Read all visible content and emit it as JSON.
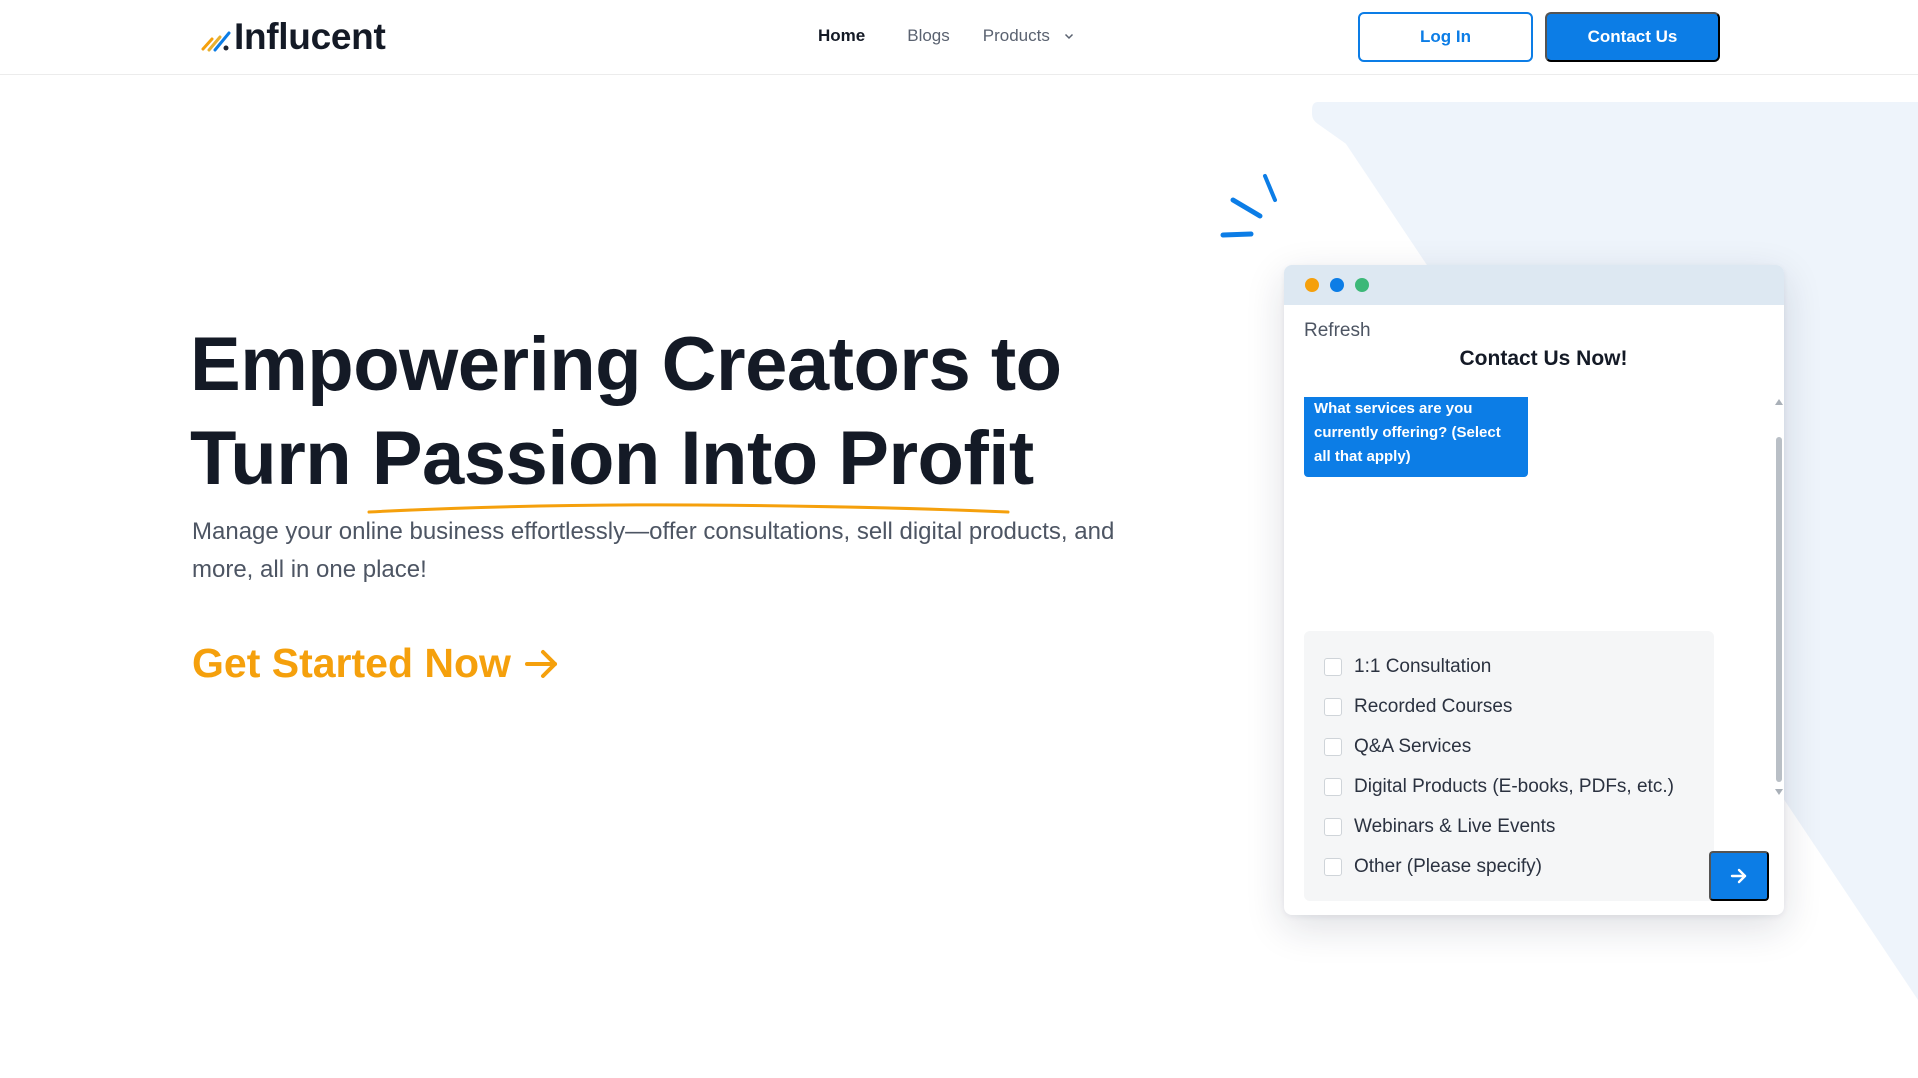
{
  "brand": {
    "name": "Influcent"
  },
  "nav": {
    "home": "Home",
    "blogs": "Blogs",
    "products": "Products"
  },
  "header_buttons": {
    "login": "Log In",
    "contact": "Contact Us"
  },
  "hero": {
    "title_line1": "Empowering Creators to",
    "title_line2_prefix": "Turn ",
    "title_line2_highlight": "Passion Into Profit",
    "subtitle": "Manage your online business effortlessly—offer consultations, sell digital products, and more, all in one place!",
    "cta": "Get Started Now"
  },
  "contact_card": {
    "refresh": "Refresh",
    "title": "Contact Us Now!",
    "question": "What services are you currently offering? (Select all that apply)",
    "options": [
      "1:1 Consultation",
      "Recorded Courses",
      "Q&A Services",
      "Digital Products (E-books, PDFs, etc.)",
      "Webinars & Live Events",
      "Other (Please specify)"
    ],
    "window_dots": [
      "#f5a00c",
      "#0c7de6",
      "#3cb878"
    ]
  },
  "colors": {
    "primary": "#0c7de6",
    "accent": "#f5a00c",
    "heading": "#141a26",
    "body": "#4d5563"
  }
}
